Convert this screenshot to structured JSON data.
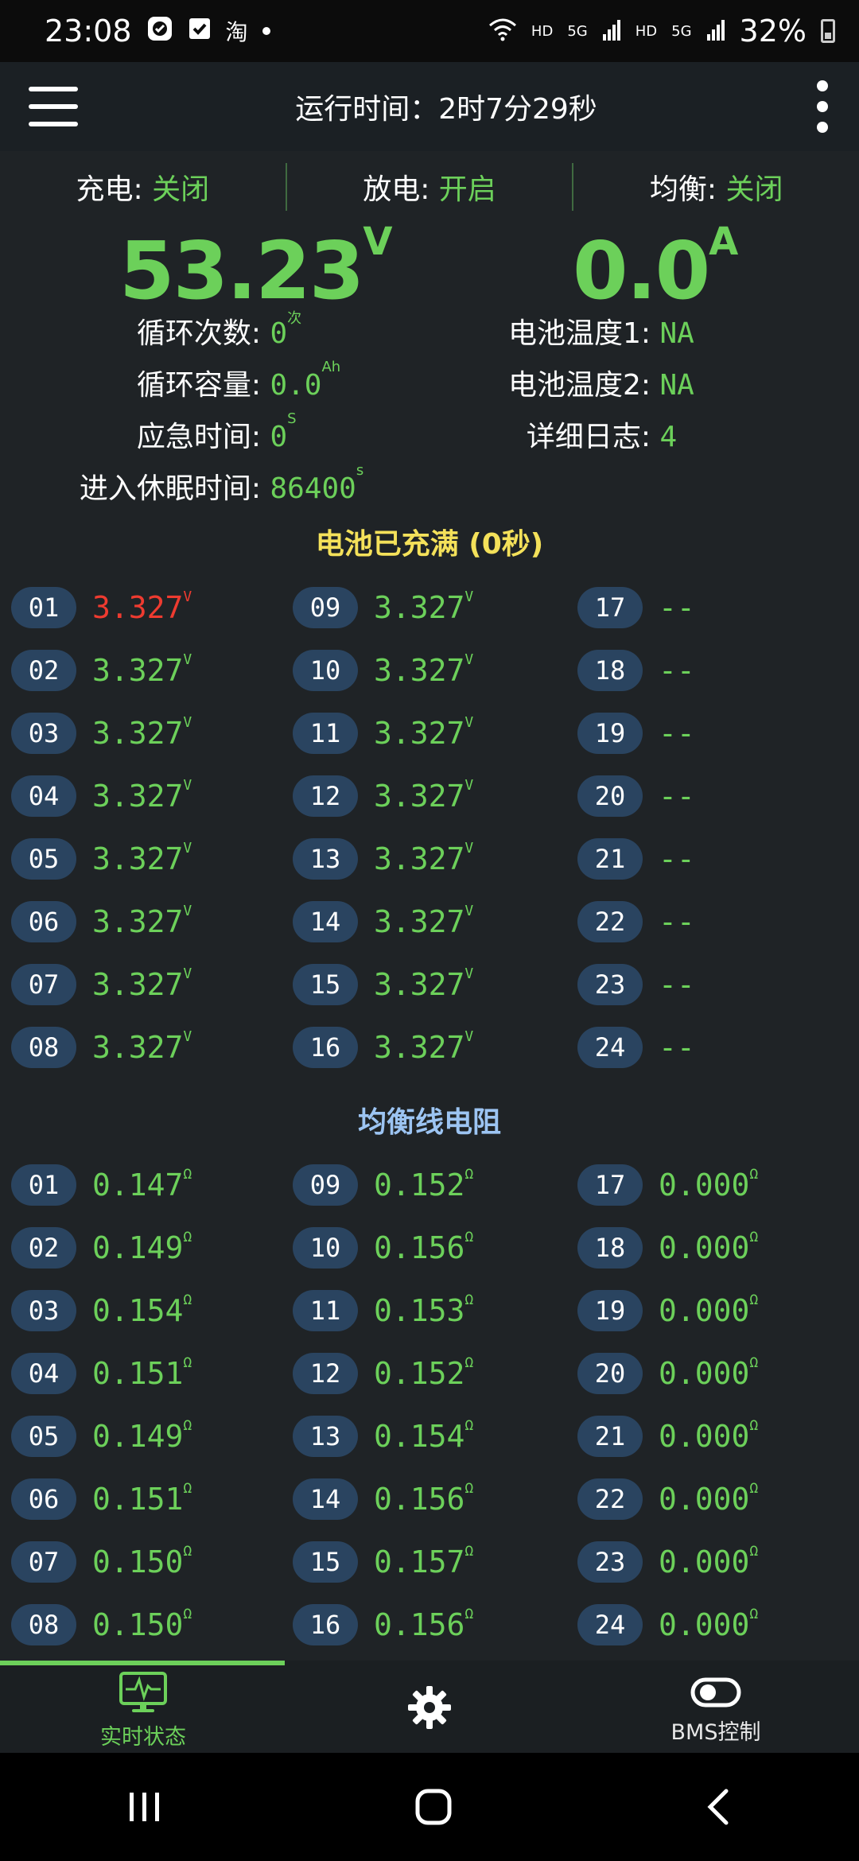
{
  "status_bar": {
    "time": "23:08",
    "battery": "32%",
    "net1": "HD",
    "net2": "5G",
    "net3": "HD",
    "net4": "5G",
    "app_icon_taobao": "淘"
  },
  "header": {
    "title": "运行时间：2时7分29秒"
  },
  "switches": {
    "charge_label": "充电:",
    "charge_value": "关闭",
    "discharge_label": "放电:",
    "discharge_value": "开启",
    "balance_label": "均衡:",
    "balance_value": "关闭"
  },
  "main": {
    "voltage": "53.23",
    "voltage_unit": "V",
    "current": "0.0",
    "current_unit": "A"
  },
  "stats": {
    "cycle_count_label": "循环次数:",
    "cycle_count": "0",
    "cycle_count_unit": "次",
    "cycle_capacity_label": "循环容量:",
    "cycle_capacity": "0.0",
    "cycle_capacity_unit": "Ah",
    "emergency_time_label": "应急时间:",
    "emergency_time": "0",
    "emergency_time_unit": "S",
    "sleep_time_label": "进入休眠时间:",
    "sleep_time": "86400",
    "sleep_time_unit": "s",
    "temp1_label": "电池温度1:",
    "temp1": "NA",
    "temp2_label": "电池温度2:",
    "temp2": "NA",
    "log_label": "详细日志:",
    "log": "4"
  },
  "cells_section": {
    "title": "电池已充满 (0秒)",
    "title_color": "#f4e15a",
    "unit": "V",
    "items": [
      {
        "id": "01",
        "value": "3.327"
      },
      {
        "id": "02",
        "value": "3.327"
      },
      {
        "id": "03",
        "value": "3.327"
      },
      {
        "id": "04",
        "value": "3.327"
      },
      {
        "id": "05",
        "value": "3.327"
      },
      {
        "id": "06",
        "value": "3.327"
      },
      {
        "id": "07",
        "value": "3.327"
      },
      {
        "id": "08",
        "value": "3.327"
      },
      {
        "id": "09",
        "value": "3.327"
      },
      {
        "id": "10",
        "value": "3.327"
      },
      {
        "id": "11",
        "value": "3.327"
      },
      {
        "id": "12",
        "value": "3.327"
      },
      {
        "id": "13",
        "value": "3.327"
      },
      {
        "id": "14",
        "value": "3.327"
      },
      {
        "id": "15",
        "value": "3.327"
      },
      {
        "id": "16",
        "value": "3.327"
      },
      {
        "id": "17",
        "value": "--"
      },
      {
        "id": "18",
        "value": "--"
      },
      {
        "id": "19",
        "value": "--"
      },
      {
        "id": "20",
        "value": "--"
      },
      {
        "id": "21",
        "value": "--"
      },
      {
        "id": "22",
        "value": "--"
      },
      {
        "id": "23",
        "value": "--"
      },
      {
        "id": "24",
        "value": "--"
      }
    ],
    "highlight_id": "01",
    "highlight_color": "#ee3b30"
  },
  "resistance_section": {
    "title": "均衡线电阻",
    "title_color": "#9cc4f2",
    "unit": "Ω",
    "items": [
      {
        "id": "01",
        "value": "0.147"
      },
      {
        "id": "02",
        "value": "0.149"
      },
      {
        "id": "03",
        "value": "0.154"
      },
      {
        "id": "04",
        "value": "0.151"
      },
      {
        "id": "05",
        "value": "0.149"
      },
      {
        "id": "06",
        "value": "0.151"
      },
      {
        "id": "07",
        "value": "0.150"
      },
      {
        "id": "08",
        "value": "0.150"
      },
      {
        "id": "09",
        "value": "0.152"
      },
      {
        "id": "10",
        "value": "0.156"
      },
      {
        "id": "11",
        "value": "0.153"
      },
      {
        "id": "12",
        "value": "0.152"
      },
      {
        "id": "13",
        "value": "0.154"
      },
      {
        "id": "14",
        "value": "0.156"
      },
      {
        "id": "15",
        "value": "0.157"
      },
      {
        "id": "16",
        "value": "0.156"
      },
      {
        "id": "17",
        "value": "0.000"
      },
      {
        "id": "18",
        "value": "0.000"
      },
      {
        "id": "19",
        "value": "0.000"
      },
      {
        "id": "20",
        "value": "0.000"
      },
      {
        "id": "21",
        "value": "0.000"
      },
      {
        "id": "22",
        "value": "0.000"
      },
      {
        "id": "23",
        "value": "0.000"
      },
      {
        "id": "24",
        "value": "0.000"
      }
    ]
  },
  "bottom_nav": {
    "items": [
      {
        "label": "实时状态",
        "icon": "monitor-icon",
        "active": true
      },
      {
        "label": "",
        "icon": "gear-icon",
        "active": false
      },
      {
        "label": "BMS控制",
        "icon": "toggle-icon",
        "active": false
      }
    ]
  },
  "colors": {
    "accent": "#6cd05a",
    "pill": "#2a4460",
    "background": "#1f2326"
  }
}
